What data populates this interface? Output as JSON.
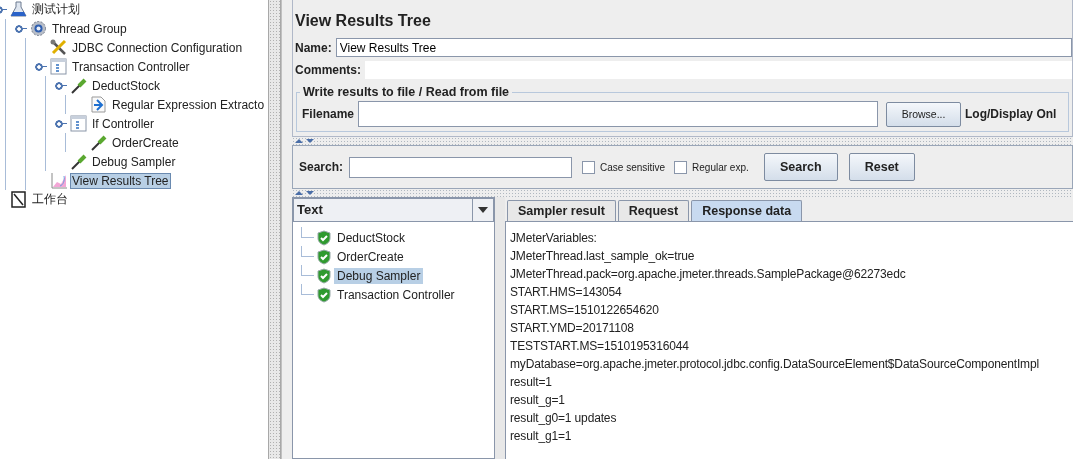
{
  "test_plan_tree": [
    {
      "label": "测试计划",
      "kind": "flask",
      "expanded": true,
      "selected": false,
      "children": [
        {
          "label": "Thread Group",
          "kind": "gear",
          "expanded": true,
          "selected": false,
          "children": [
            {
              "label": "JDBC Connection Configuration",
              "kind": "tools",
              "expanded": false,
              "selected": false
            },
            {
              "label": "Transaction Controller",
              "kind": "controller",
              "expanded": true,
              "selected": false,
              "children": [
                {
                  "label": "DeductStock",
                  "kind": "sampler",
                  "expanded": true,
                  "selected": false,
                  "children": [
                    {
                      "label": "Regular Expression Extracto",
                      "kind": "extractor",
                      "expanded": false,
                      "selected": false
                    }
                  ]
                },
                {
                  "label": "If Controller",
                  "kind": "controller",
                  "expanded": true,
                  "selected": false,
                  "children": [
                    {
                      "label": "OrderCreate",
                      "kind": "sampler",
                      "expanded": false,
                      "selected": false
                    }
                  ]
                },
                {
                  "label": "Debug Sampler",
                  "kind": "sampler",
                  "expanded": false,
                  "selected": false
                }
              ]
            },
            {
              "label": "View Results Tree",
              "kind": "graph",
              "expanded": false,
              "selected": true
            }
          ]
        }
      ]
    },
    {
      "label": "工作台",
      "kind": "notebook",
      "expanded": false,
      "selected": false
    }
  ],
  "editor": {
    "title": "View Results Tree",
    "name_label": "Name:",
    "name_value": "View Results Tree",
    "comments_label": "Comments:",
    "file_group": {
      "legend": "Write results to file / Read from file",
      "filename_label": "Filename",
      "browse_button": "Browse...",
      "log_display_label": "Log/Display Onl"
    }
  },
  "search_bar": {
    "label": "Search:",
    "options": [
      {
        "label": "Case sensitive",
        "checked": false
      },
      {
        "label": "Regular exp.",
        "checked": false
      }
    ],
    "buttons": [
      "Search",
      "Reset"
    ]
  },
  "results": {
    "renderer": "Text",
    "items": [
      {
        "label": "DeductStock",
        "passed": true,
        "selected": false
      },
      {
        "label": "OrderCreate",
        "passed": true,
        "selected": false
      },
      {
        "label": "Debug Sampler",
        "passed": true,
        "selected": true
      },
      {
        "label": "Transaction Controller",
        "passed": true,
        "selected": false
      }
    ]
  },
  "tabs": [
    {
      "label": "Sampler result",
      "selected": false
    },
    {
      "label": "Request",
      "selected": false
    },
    {
      "label": "Response data",
      "selected": true
    }
  ],
  "response_lines": [
    "JMeterVariables:",
    "JMeterThread.last_sample_ok=true",
    "JMeterThread.pack=org.apache.jmeter.threads.SamplePackage@62273edc",
    "START.HMS=143054",
    "START.MS=1510122654620",
    "START.YMD=20171108",
    "TESTSTART.MS=1510195316044",
    "myDatabase=org.apache.jmeter.protocol.jdbc.config.DataSourceElement$DataSourceComponentImpl",
    "result=1",
    "result_g=1",
    "result_g0=1 updates",
    "result_g1=1"
  ]
}
